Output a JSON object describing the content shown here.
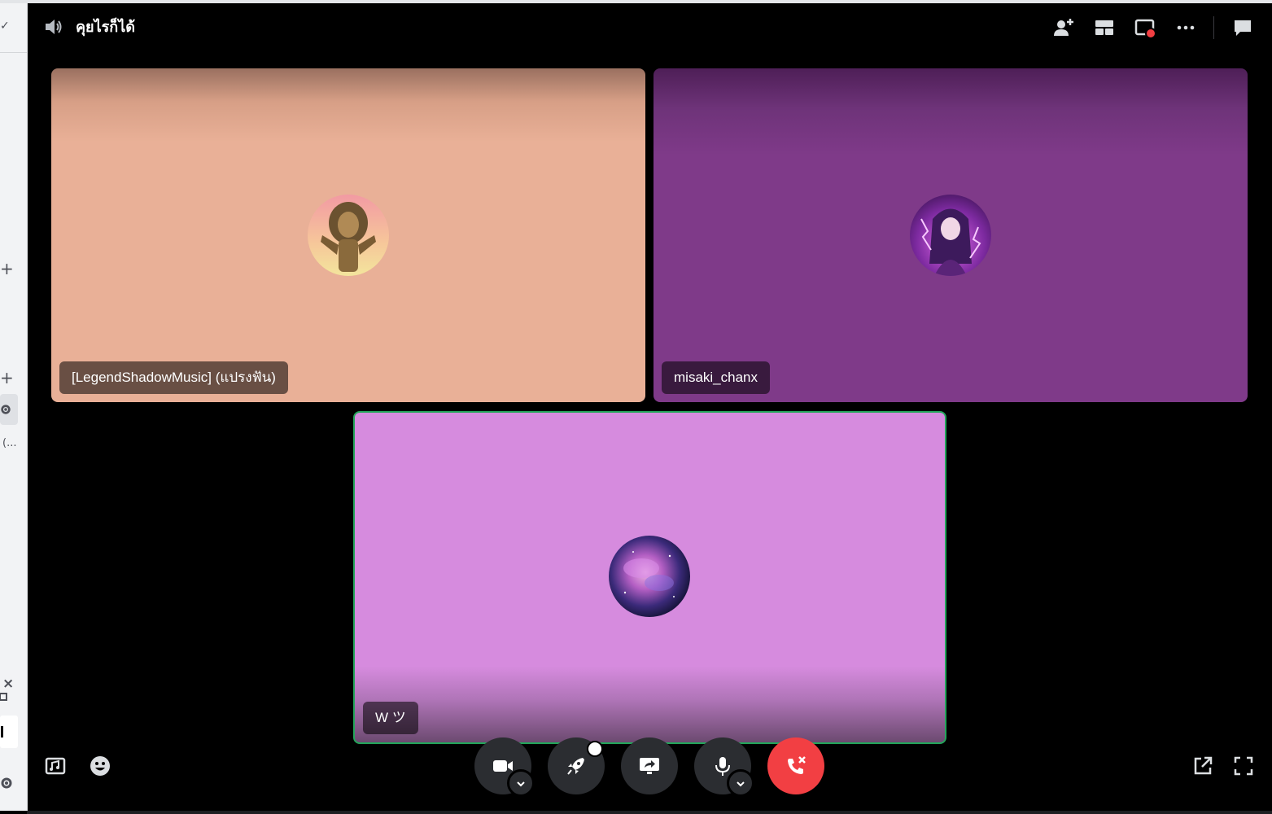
{
  "header": {
    "channel_name": "คุยไรก็ได้",
    "icons": [
      "speaker-icon",
      "add-friend-icon",
      "grid-layout-icon",
      "screen-live-icon",
      "more-icon",
      "chat-icon"
    ]
  },
  "sidebar": {
    "check_glyph": "✓",
    "plus_glyph": "+",
    "truncated_text": "(...",
    "close_glyph": "×"
  },
  "participants": [
    {
      "name": "[LegendShadowMusic] (แปรงฟัน)",
      "avatar": "lion-avatar",
      "tile_color": "#e9b097"
    },
    {
      "name": "misaki_chanx",
      "avatar": "cosplay-avatar",
      "tile_color": "#7f3a89"
    },
    {
      "name": "W ツ",
      "avatar": "galaxy-avatar",
      "tile_color": "#d68bde",
      "speaking": true
    }
  ],
  "controls": [
    "camera-button",
    "activity-button",
    "screen-share-button",
    "microphone-button",
    "disconnect-button"
  ],
  "colors": {
    "speaking_border": "#23a55a",
    "disconnect": "#f23f43",
    "control_bg": "#2b2d31"
  }
}
